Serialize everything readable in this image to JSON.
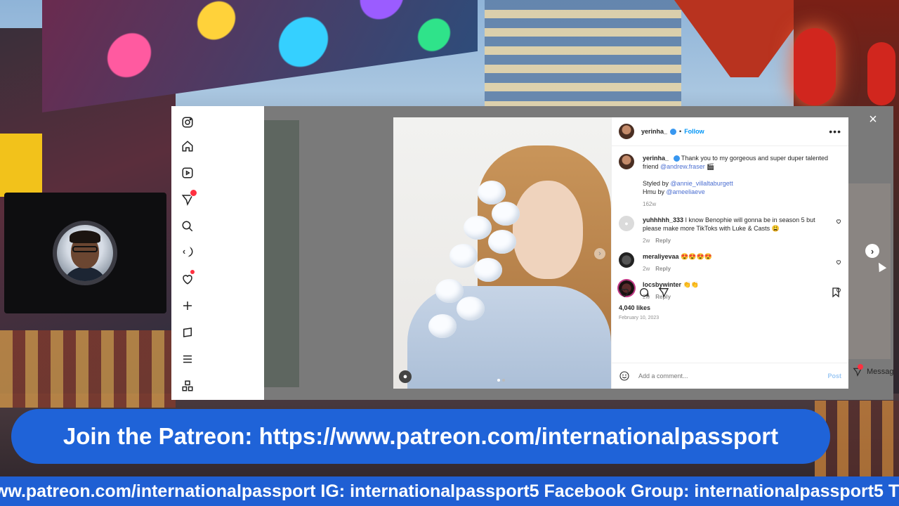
{
  "instagram": {
    "post": {
      "username": "yerinha_",
      "follow_label": "Follow",
      "more_label": "•••",
      "caption_text": "Thank you to my gorgeous and super duper talented friend",
      "caption_mention": "@andrew.fraser",
      "caption_emoji": "🎬",
      "styled_prefix": "Styled by",
      "styled_mention": "@annie_villaltaburgett",
      "hmu_prefix": "Hmu by",
      "hmu_mention": "@ameeliaeve",
      "caption_age": "162w",
      "likes": "4,040 likes",
      "date": "February 10, 2023",
      "comment_placeholder": "Add a comment...",
      "post_label": "Post"
    },
    "comments": [
      {
        "username": "yuhhhhh_333",
        "text": "I know Benophie will gonna be in season 5 but please make more TikToks with Luke & Casts 😩",
        "age": "2w",
        "reply": "Reply"
      },
      {
        "username": "meraliyevaa",
        "text": "😍😍😍😍",
        "age": "2w",
        "reply": "Reply"
      },
      {
        "username": "locsbywinter",
        "text": "👏👏",
        "age": "2w",
        "reply": "Reply"
      }
    ],
    "messages_label": "Messages",
    "close_label": "×",
    "prev_label": "‹",
    "next_label": "›"
  },
  "banner": {
    "patreon": "Join the Patreon: https://www.patreon.com/internationalpassport",
    "ticker": "ww.patreon.com/internationalpassport IG: internationalpassport5 Facebook Group: internationalpassport5 T"
  },
  "icons": [
    "instagram-icon",
    "home-icon",
    "reels-icon",
    "messenger-icon",
    "search-icon",
    "explore-icon",
    "heart-icon",
    "create-icon",
    "threads-icon",
    "menu-icon",
    "also-from-meta-icon"
  ],
  "colors": {
    "accent": "#0095f6",
    "banner": "#1f63d8",
    "ticker": "#1f5fd3"
  }
}
